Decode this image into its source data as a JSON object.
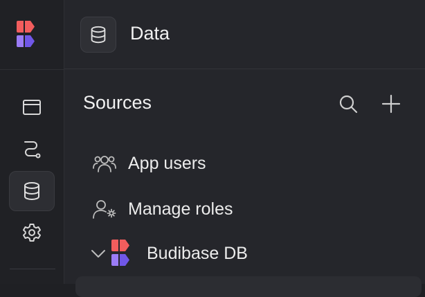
{
  "header": {
    "title": "Data",
    "icon": "database-icon"
  },
  "sidebar_rail": {
    "items": [
      {
        "name": "screens",
        "icon": "browser-window-icon"
      },
      {
        "name": "automations",
        "icon": "route-icon"
      },
      {
        "name": "data",
        "icon": "database-icon",
        "active": true
      },
      {
        "name": "settings",
        "icon": "gear-icon"
      }
    ]
  },
  "sources": {
    "title": "Sources",
    "search_icon": "search-icon",
    "add_icon": "plus-icon",
    "items": [
      {
        "label": "App users",
        "icon": "users-icon"
      },
      {
        "label": "Manage roles",
        "icon": "user-gear-icon"
      }
    ],
    "datasource": {
      "label": "Budibase DB",
      "expanded": true
    }
  },
  "colors": {
    "logo_red": "#f25d5d",
    "logo_purple": "#8b6cf6",
    "background": "#25262b",
    "rail": "#202125"
  }
}
